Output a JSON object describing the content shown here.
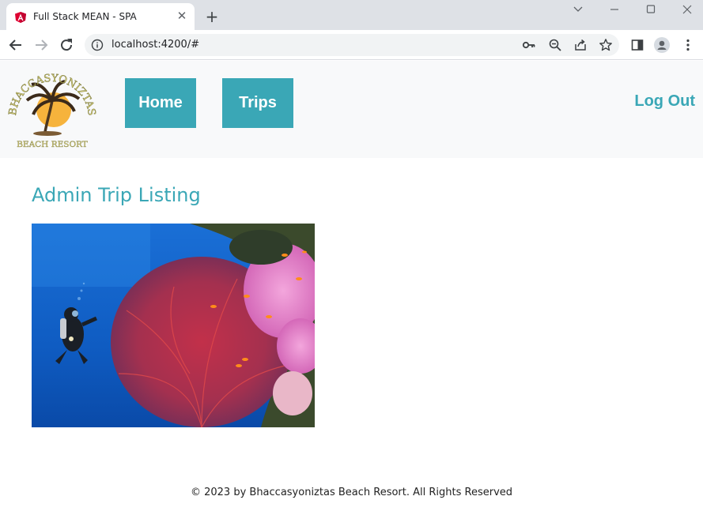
{
  "browser": {
    "tab_title": "Full Stack MEAN - SPA",
    "url": "localhost:4200/#",
    "favicon_icon": "angular-logo-icon",
    "controls": [
      "back-icon",
      "forward-icon",
      "reload-icon"
    ],
    "omnibox_icons": [
      "key-icon",
      "zoom-out-icon",
      "share-icon",
      "bookmark-star-icon"
    ],
    "toolbar_icons": [
      "side-panel-icon",
      "profile-icon",
      "menu-icon"
    ]
  },
  "header": {
    "logo_top_text": "BHACCASYONIZTAS",
    "logo_bottom_text": "BEACH RESORT",
    "nav": {
      "home": "Home",
      "trips": "Trips"
    },
    "logout": "Log Out"
  },
  "main": {
    "heading": "Admin Trip Listing"
  },
  "footer": {
    "text": "© 2023 by Bhaccasyoniztas Beach Resort. All Rights Reserved"
  },
  "colors": {
    "accent": "#3aa7b6",
    "header_bg": "#f8f9fa",
    "chrome_bg": "#dee1e6"
  }
}
